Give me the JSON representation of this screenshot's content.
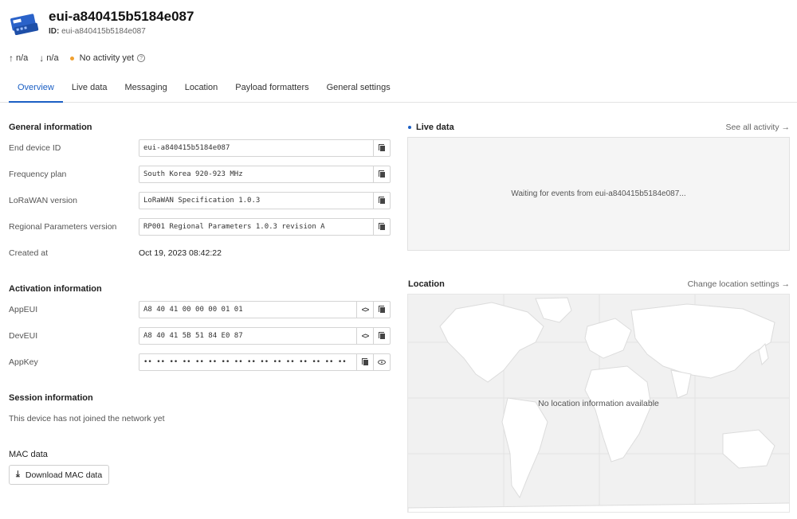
{
  "device": {
    "title": "eui-a840415b5184e087",
    "id_label": "ID:",
    "id_value": "eui-a840415b5184e087"
  },
  "status": {
    "uplink": "n/a",
    "downlink": "n/a",
    "activity": "No activity yet",
    "dot_color": "#f0a030"
  },
  "tabs": [
    {
      "label": "Overview",
      "active": true
    },
    {
      "label": "Live data"
    },
    {
      "label": "Messaging"
    },
    {
      "label": "Location"
    },
    {
      "label": "Payload formatters"
    },
    {
      "label": "General settings"
    }
  ],
  "general": {
    "title": "General information",
    "end_device_id_label": "End device ID",
    "end_device_id": "eui-a840415b5184e087",
    "frequency_plan_label": "Frequency plan",
    "frequency_plan": "South Korea 920-923 MHz",
    "lorawan_version_label": "LoRaWAN version",
    "lorawan_version": "LoRaWAN Specification 1.0.3",
    "regional_params_label": "Regional Parameters version",
    "regional_params": "RP001 Regional Parameters 1.0.3 revision A",
    "created_at_label": "Created at",
    "created_at": "Oct 19, 2023 08:42:22"
  },
  "activation": {
    "title": "Activation information",
    "app_eui_label": "AppEUI",
    "app_eui": "A8 40 41 00 00 00 01 01",
    "dev_eui_label": "DevEUI",
    "dev_eui": "A8 40 41 5B 51 84 E0 87",
    "app_key_label": "AppKey",
    "app_key": "•• •• •• •• •• •• •• •• •• •• •• •• •• •• •• ••"
  },
  "session": {
    "title": "Session information",
    "message": "This device has not joined the network yet"
  },
  "mac": {
    "title": "MAC data",
    "download_label": "Download MAC data"
  },
  "live_data": {
    "title": "Live data",
    "link": "See all activity →",
    "waiting": "Waiting for events from eui-a840415b5184e087..."
  },
  "location": {
    "title": "Location",
    "link": "Change location settings →",
    "message": "No location information available"
  },
  "colors": {
    "accent": "#1b5fc4"
  }
}
